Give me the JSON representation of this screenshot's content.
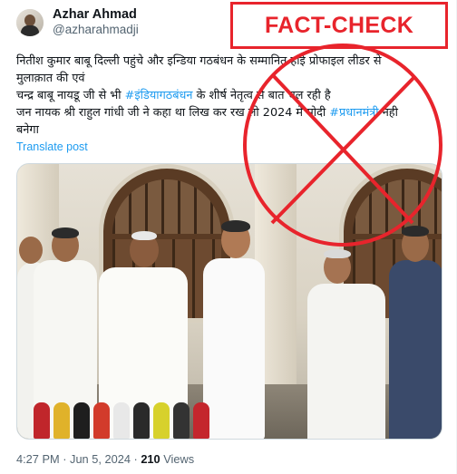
{
  "author": {
    "display_name": "Azhar Ahmad",
    "handle": "@azharahmadji"
  },
  "fact_check_label": "FACT-CHECK",
  "tweet": {
    "line1": "नितीश कुमार बाबू दिल्ली पहुंचे और इन्डिया गठबंधन के सम्मानित हाई प्रोफाइल लीडर से",
    "line2": "मुलाक़ात की एवं",
    "line3_pre": "चन्द्र बाबू नायडू जी से भी ",
    "line3_tag": "#इंडियागठबंधन",
    "line3_post": "  के शीर्ष नेतृत्व से बात चल रही है",
    "line4_pre": "जन नायक श्री राहुल गांधी जी ने कहा था लिख कर रख लो 2024 में मोदी ",
    "line4_tag": "#प्रधानमंत्री",
    "line4_post": " नही",
    "line5": "बनेगा"
  },
  "translate_label": "Translate post",
  "footer": {
    "time": "4:27 PM",
    "sep1": " · ",
    "date": "Jun 5, 2024",
    "sep2": " · ",
    "views_count": "210",
    "views_label": " Views"
  },
  "colors": {
    "fact_check_red": "#e8242c",
    "link_blue": "#1d9bf0"
  },
  "icons": {
    "fact_check_mark": "red-circle-cross"
  }
}
